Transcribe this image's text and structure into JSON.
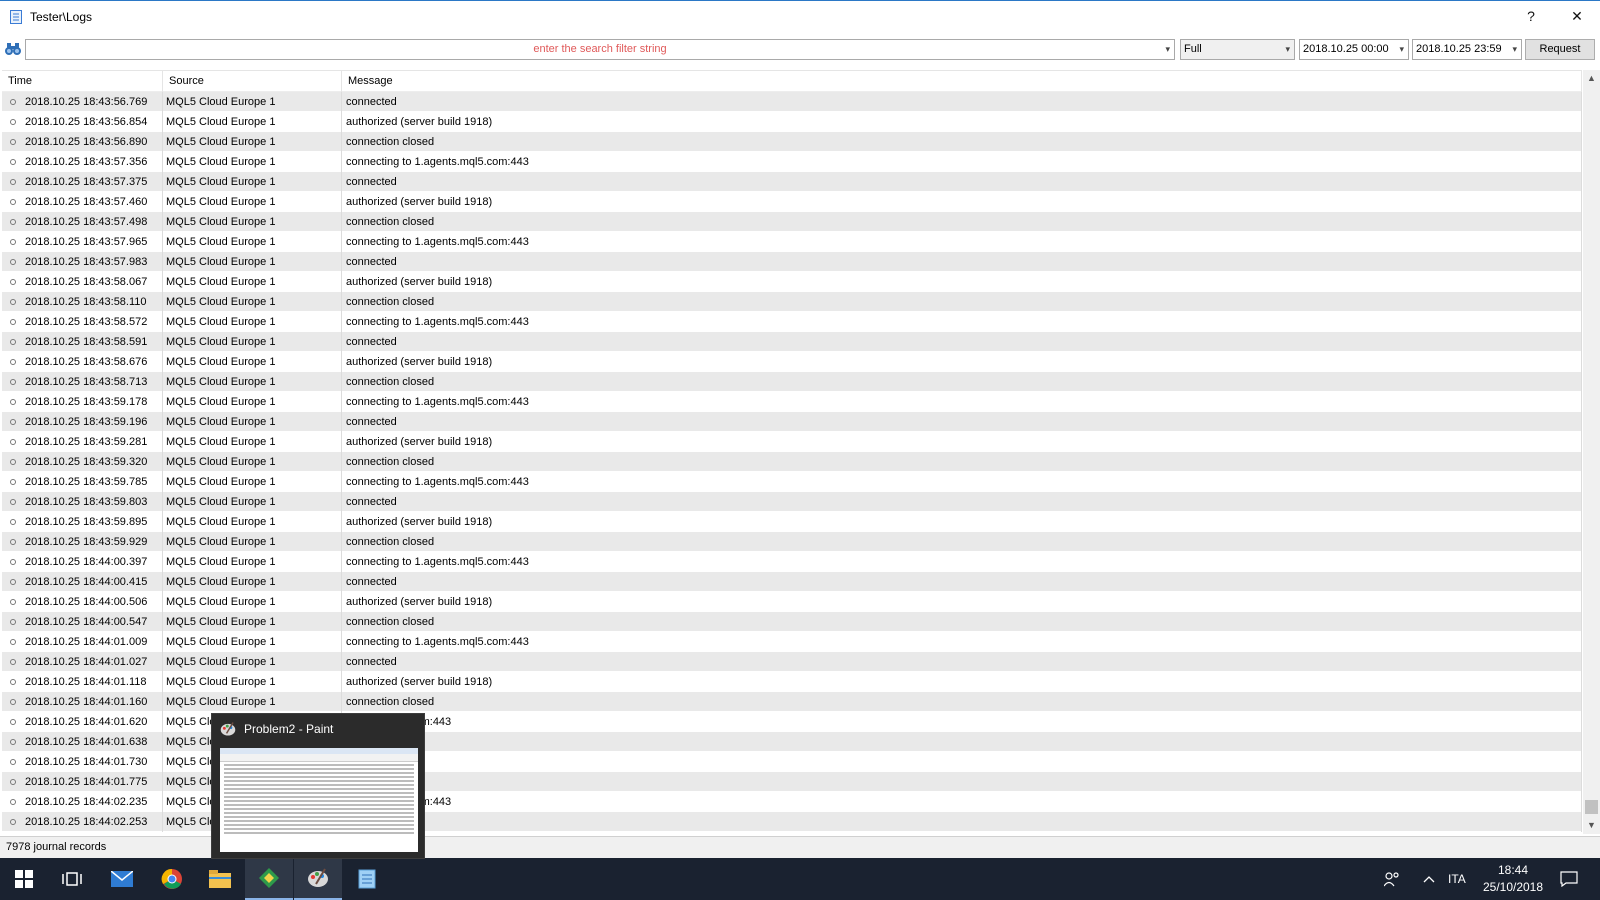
{
  "window": {
    "title": "Tester\\Logs",
    "help_label": "?",
    "close_label": "✕"
  },
  "filter": {
    "search_placeholder": "enter the search filter string",
    "mode": "Full",
    "date_from": "2018.10.25 00:00",
    "date_to": "2018.10.25 23:59",
    "request_label": "Request"
  },
  "table": {
    "headers": [
      "Time",
      "Source",
      "Message"
    ],
    "rows": [
      [
        "2018.10.25 18:43:56.769",
        "MQL5 Cloud Europe 1",
        "connected"
      ],
      [
        "2018.10.25 18:43:56.854",
        "MQL5 Cloud Europe 1",
        "authorized (server build 1918)"
      ],
      [
        "2018.10.25 18:43:56.890",
        "MQL5 Cloud Europe 1",
        "connection closed"
      ],
      [
        "2018.10.25 18:43:57.356",
        "MQL5 Cloud Europe 1",
        "connecting to 1.agents.mql5.com:443"
      ],
      [
        "2018.10.25 18:43:57.375",
        "MQL5 Cloud Europe 1",
        "connected"
      ],
      [
        "2018.10.25 18:43:57.460",
        "MQL5 Cloud Europe 1",
        "authorized (server build 1918)"
      ],
      [
        "2018.10.25 18:43:57.498",
        "MQL5 Cloud Europe 1",
        "connection closed"
      ],
      [
        "2018.10.25 18:43:57.965",
        "MQL5 Cloud Europe 1",
        "connecting to 1.agents.mql5.com:443"
      ],
      [
        "2018.10.25 18:43:57.983",
        "MQL5 Cloud Europe 1",
        "connected"
      ],
      [
        "2018.10.25 18:43:58.067",
        "MQL5 Cloud Europe 1",
        "authorized (server build 1918)"
      ],
      [
        "2018.10.25 18:43:58.110",
        "MQL5 Cloud Europe 1",
        "connection closed"
      ],
      [
        "2018.10.25 18:43:58.572",
        "MQL5 Cloud Europe 1",
        "connecting to 1.agents.mql5.com:443"
      ],
      [
        "2018.10.25 18:43:58.591",
        "MQL5 Cloud Europe 1",
        "connected"
      ],
      [
        "2018.10.25 18:43:58.676",
        "MQL5 Cloud Europe 1",
        "authorized (server build 1918)"
      ],
      [
        "2018.10.25 18:43:58.713",
        "MQL5 Cloud Europe 1",
        "connection closed"
      ],
      [
        "2018.10.25 18:43:59.178",
        "MQL5 Cloud Europe 1",
        "connecting to 1.agents.mql5.com:443"
      ],
      [
        "2018.10.25 18:43:59.196",
        "MQL5 Cloud Europe 1",
        "connected"
      ],
      [
        "2018.10.25 18:43:59.281",
        "MQL5 Cloud Europe 1",
        "authorized (server build 1918)"
      ],
      [
        "2018.10.25 18:43:59.320",
        "MQL5 Cloud Europe 1",
        "connection closed"
      ],
      [
        "2018.10.25 18:43:59.785",
        "MQL5 Cloud Europe 1",
        "connecting to 1.agents.mql5.com:443"
      ],
      [
        "2018.10.25 18:43:59.803",
        "MQL5 Cloud Europe 1",
        "connected"
      ],
      [
        "2018.10.25 18:43:59.895",
        "MQL5 Cloud Europe 1",
        "authorized (server build 1918)"
      ],
      [
        "2018.10.25 18:43:59.929",
        "MQL5 Cloud Europe 1",
        "connection closed"
      ],
      [
        "2018.10.25 18:44:00.397",
        "MQL5 Cloud Europe 1",
        "connecting to 1.agents.mql5.com:443"
      ],
      [
        "2018.10.25 18:44:00.415",
        "MQL5 Cloud Europe 1",
        "connected"
      ],
      [
        "2018.10.25 18:44:00.506",
        "MQL5 Cloud Europe 1",
        "authorized (server build 1918)"
      ],
      [
        "2018.10.25 18:44:00.547",
        "MQL5 Cloud Europe 1",
        "connection closed"
      ],
      [
        "2018.10.25 18:44:01.009",
        "MQL5 Cloud Europe 1",
        "connecting to 1.agents.mql5.com:443"
      ],
      [
        "2018.10.25 18:44:01.027",
        "MQL5 Cloud Europe 1",
        "connected"
      ],
      [
        "2018.10.25 18:44:01.118",
        "MQL5 Cloud Europe 1",
        "authorized (server build 1918)"
      ],
      [
        "2018.10.25 18:44:01.160",
        "MQL5 Cloud Europe 1",
        "connection closed"
      ],
      [
        "2018.10.25 18:44:01.620",
        "MQL5 Clo",
        "agents.mql5.com:443"
      ],
      [
        "2018.10.25 18:44:01.638",
        "MQL5 Clo",
        ""
      ],
      [
        "2018.10.25 18:44:01.730",
        "MQL5 Clo",
        "er build 1918)"
      ],
      [
        "2018.10.25 18:44:01.775",
        "MQL5 Clo",
        "d"
      ],
      [
        "2018.10.25 18:44:02.235",
        "MQL5 Clo",
        "agents.mql5.com:443"
      ],
      [
        "2018.10.25 18:44:02.253",
        "MQL5 Clo",
        ""
      ]
    ]
  },
  "status": {
    "records": "7978 journal records"
  },
  "preview": {
    "title": "Problem2 - Paint"
  },
  "taskbar": {
    "language": "ITA",
    "time": "18:44",
    "date": "25/10/2018",
    "icons": [
      "windows-start-icon",
      "task-view-icon",
      "mail-icon",
      "chrome-icon",
      "file-explorer-icon",
      "metatrader-icon",
      "paint-icon",
      "notepad-icon"
    ]
  }
}
